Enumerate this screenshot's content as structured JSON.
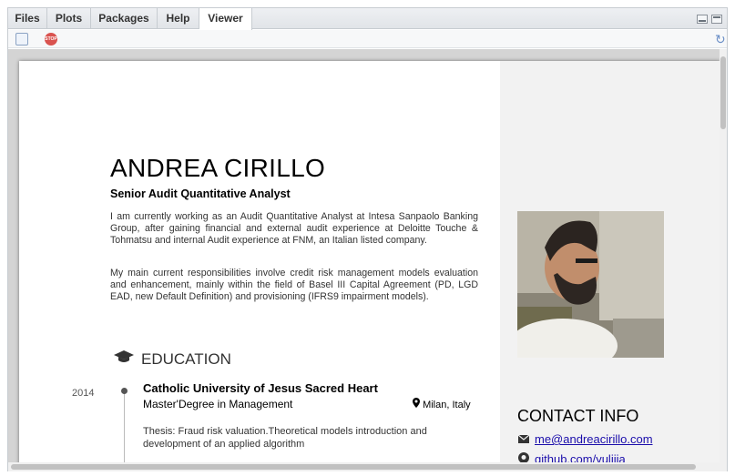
{
  "tabs": [
    {
      "label": "Files",
      "active": false
    },
    {
      "label": "Plots",
      "active": false
    },
    {
      "label": "Packages",
      "active": false
    },
    {
      "label": "Help",
      "active": false
    },
    {
      "label": "Viewer",
      "active": true
    }
  ],
  "toolbar": {
    "popout_icon": "show-in-new-window-icon",
    "stop_label": "STOP",
    "refresh_icon": "refresh-icon"
  },
  "resume": {
    "name": "ANDREA CIRILLO",
    "title": "Senior Audit Quantitative Analyst",
    "intro_paragraphs": [
      "I am currently working as an Audit Quantitative Analyst at Intesa Sanpaolo Banking Group, after gaining financial and external audit experience at Deloitte Touche & Tohmatsu and internal Audit experience at FNM, an Italian listed company.",
      "My main current responsibilities involve credit risk management models evaluation and enhancement, mainly within the field of Basel III Capital Agreement (PD, LGD EAD, new Default Definition) and provisioning (IFRS9 impairment models)."
    ],
    "education": {
      "heading": "EDUCATION",
      "icon": "graduation-cap-icon",
      "entries": [
        {
          "year": "2014",
          "institution": "Catholic University of Jesus Sacred Heart",
          "degree": "Master'Degree in Management",
          "location": "Milan, Italy",
          "description": "Thesis: Fraud risk valuation.Theoretical models introduction and development of an applied algorithm"
        }
      ]
    },
    "sidebar": {
      "photo_icon": "profile-photo",
      "contact_heading": "CONTACT INFO",
      "contacts": [
        {
          "icon": "envelope-icon",
          "text": "me@andreacirillo.com"
        },
        {
          "icon": "github-icon",
          "text": "github.com/yulijia"
        }
      ]
    }
  },
  "colors": {
    "link": "#1a0dab",
    "page_aside": "#f2f2f2",
    "viewer_bg": "#d4d4d4"
  }
}
